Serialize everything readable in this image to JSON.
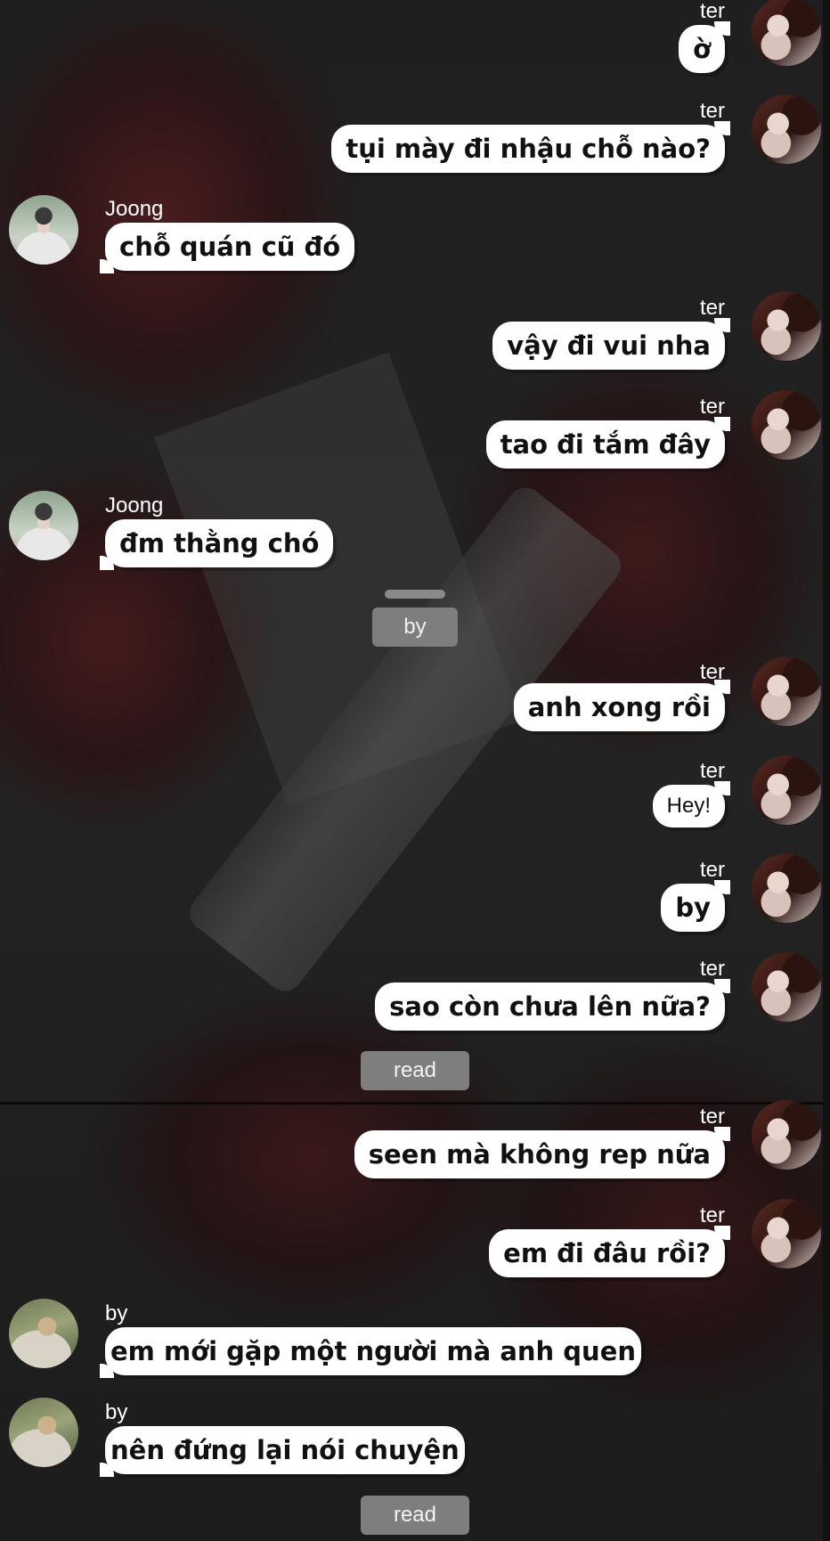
{
  "messages": [
    {
      "sender": "ter",
      "text": "ờ"
    },
    {
      "sender": "ter",
      "text": "tụi mày đi nhậu chỗ nào?"
    },
    {
      "sender": "Joong",
      "text": "chỗ quán cũ đó"
    },
    {
      "sender": "ter",
      "text": "vậy đi vui nha"
    },
    {
      "sender": "ter",
      "text": "tao đi tắm đây"
    },
    {
      "sender": "Joong",
      "text": "đm thằng chó"
    },
    {
      "sender": "ter",
      "text": "anh xong rồi"
    },
    {
      "sender": "ter",
      "text": "Hey!"
    },
    {
      "sender": "ter",
      "text": "by"
    },
    {
      "sender": "ter",
      "text": "sao còn chưa lên nữa?"
    },
    {
      "sender": "ter",
      "text": "seen mà không rep nữa"
    },
    {
      "sender": "ter",
      "text": "em đi đâu rồi?"
    },
    {
      "sender": "by",
      "text": "em mới gặp một người mà anh quen"
    },
    {
      "sender": "by",
      "text": "nên đứng lại nói chuyện"
    }
  ],
  "system": {
    "by_label": "by",
    "read_label_1": "read",
    "read_label_2": "read"
  }
}
